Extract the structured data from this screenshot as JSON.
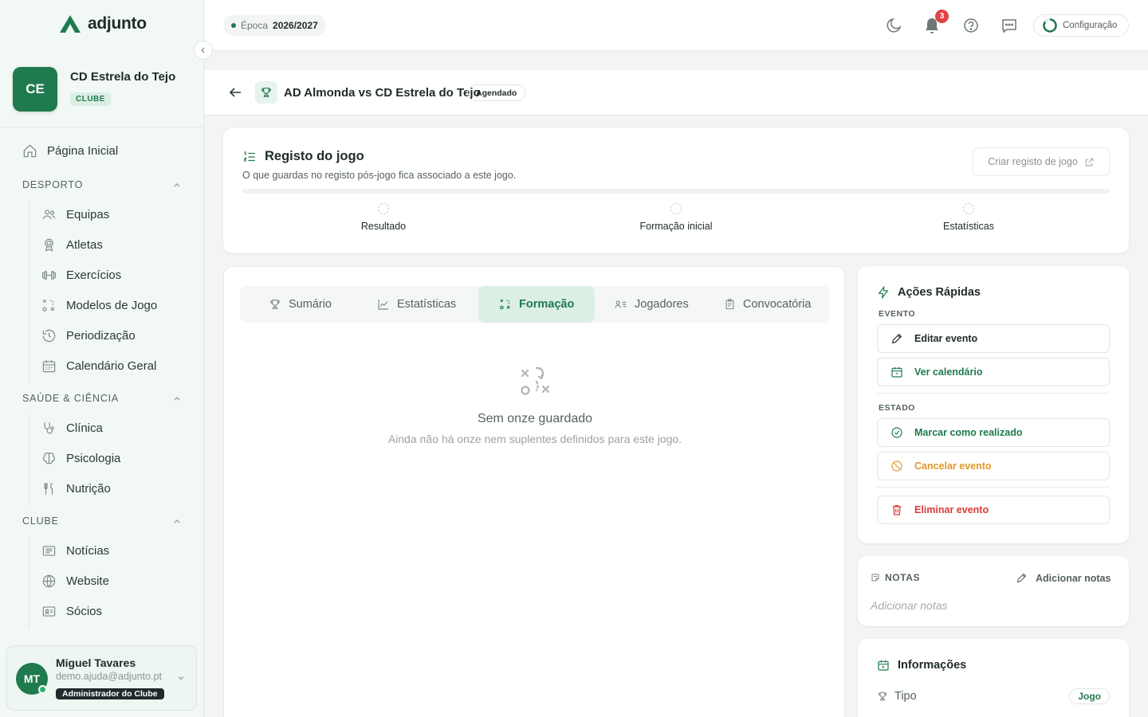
{
  "app": {
    "name": "adjunto"
  },
  "club": {
    "initials": "CE",
    "name": "CD Estrela do Tejo",
    "badge": "CLUBE"
  },
  "nav": {
    "home": "Página Inicial",
    "sections": [
      {
        "title": "DESPORTO",
        "items": [
          "Equipas",
          "Atletas",
          "Exercícios",
          "Modelos de Jogo",
          "Periodização",
          "Calendário Geral"
        ]
      },
      {
        "title": "SAÚDE & CIÊNCIA",
        "items": [
          "Clínica",
          "Psicologia",
          "Nutrição"
        ]
      },
      {
        "title": "CLUBE",
        "items": [
          "Notícias",
          "Website",
          "Sócios"
        ]
      }
    ]
  },
  "user": {
    "initials": "MT",
    "name": "Miguel Tavares",
    "email": "demo.ajuda@adjunto.pt",
    "role": "Administrador do Clube"
  },
  "topbar": {
    "season_label": "Época",
    "season_value": "2026/2027",
    "notifications": "3",
    "config_label": "Configuração"
  },
  "match": {
    "title": "AD Almonda vs CD Estrela do Tejo",
    "status": "Agendado"
  },
  "record": {
    "title": "Registo do jogo",
    "subtitle": "O que guardas no registo pós-jogo fica associado a este jogo.",
    "create_button": "Criar registo de jogo",
    "steps": [
      "Resultado",
      "Formação inicial",
      "Estatísticas"
    ]
  },
  "tabs": [
    "Sumário",
    "Estatísticas",
    "Formação",
    "Jogadores",
    "Convocatória"
  ],
  "active_tab": "Formação",
  "empty_state": {
    "title": "Sem onze guardado",
    "subtitle": "Ainda não há onze nem suplentes definidos para este jogo."
  },
  "quick_actions": {
    "title": "Ações Rápidas",
    "event_label": "EVENTO",
    "edit": "Editar evento",
    "calendar": "Ver calendário",
    "state_label": "ESTADO",
    "mark_done": "Marcar como realizado",
    "cancel": "Cancelar evento",
    "delete": "Eliminar evento"
  },
  "notes": {
    "label": "NOTAS",
    "add": "Adicionar notas",
    "placeholder": "Adicionar notas"
  },
  "info": {
    "title": "Informações",
    "type_label": "Tipo",
    "type_value": "Jogo"
  },
  "colors": {
    "brand": "#1f7a4e",
    "danger": "#d93a3a",
    "warning": "#e0982a",
    "success": "#1f7a4e"
  }
}
